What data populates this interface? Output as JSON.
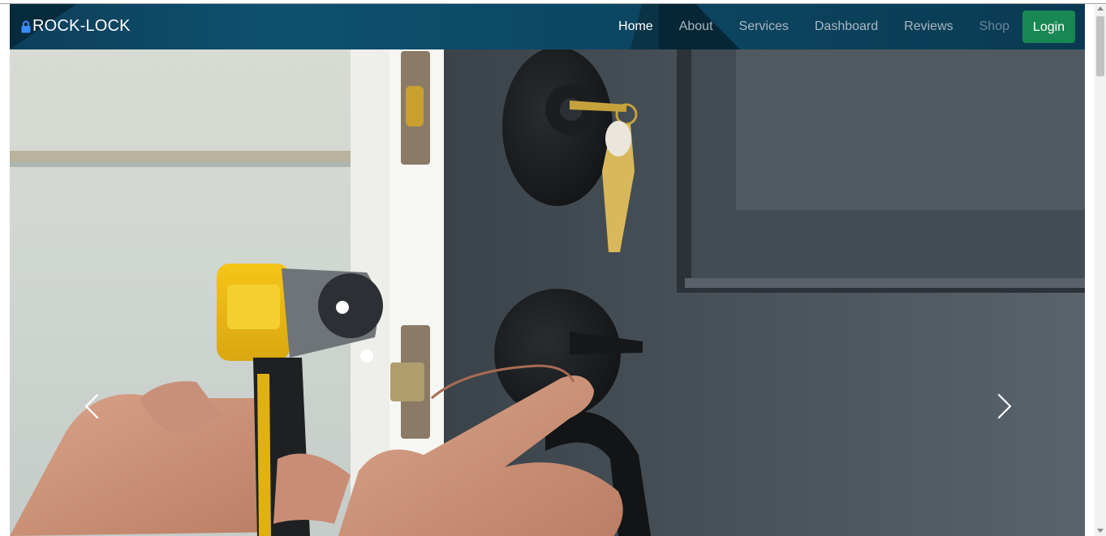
{
  "brand": {
    "name": "ROCK-LOCK",
    "icon": "lock-icon"
  },
  "nav": {
    "items": [
      {
        "label": "Home",
        "state": "active"
      },
      {
        "label": "About",
        "state": "normal"
      },
      {
        "label": "Services",
        "state": "normal"
      },
      {
        "label": "Dashboard",
        "state": "normal"
      },
      {
        "label": "Reviews",
        "state": "normal"
      },
      {
        "label": "Shop",
        "state": "muted"
      }
    ],
    "login_label": "Login"
  },
  "carousel": {
    "prev_icon": "chevron-left-icon",
    "next_icon": "chevron-right-icon"
  },
  "colors": {
    "navbar": "#0d4560",
    "login": "#198754",
    "active_link": "#ffffff",
    "link": "#aab7c1"
  }
}
